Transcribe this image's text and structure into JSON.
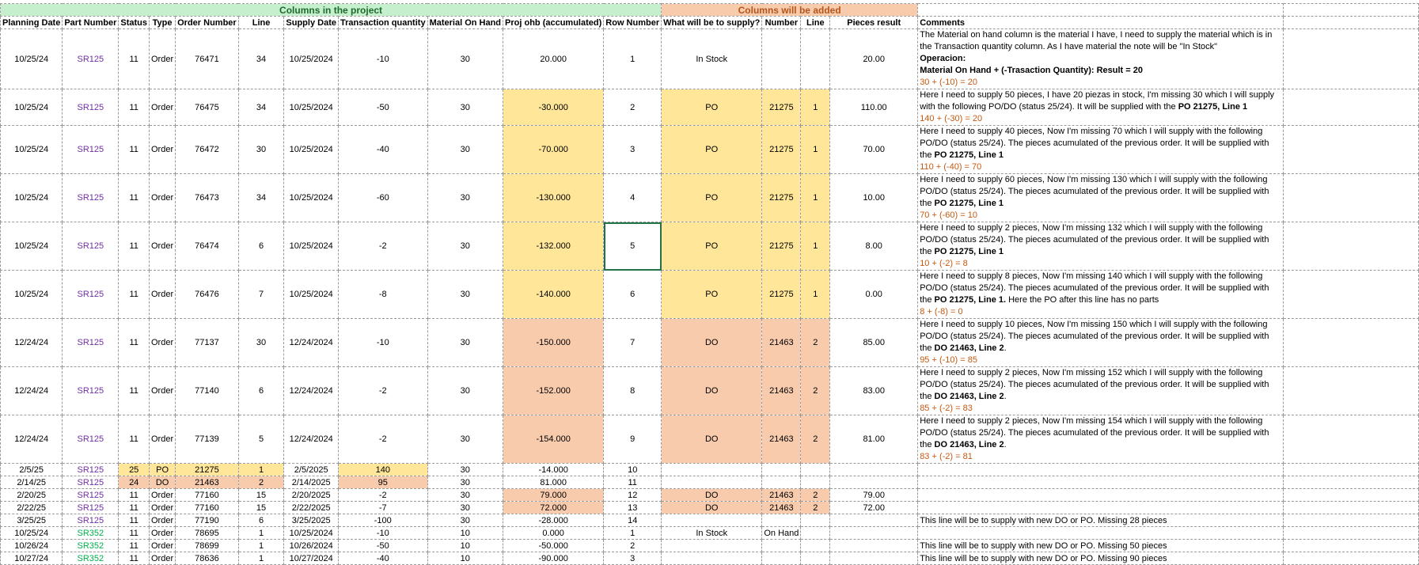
{
  "band": {
    "project": "Columns in the project",
    "added": "Columns will be added"
  },
  "headers": [
    "Planning Date",
    "Part Number",
    "Status",
    "Type",
    "Order Number",
    "Line",
    "Supply Date",
    "Transaction quantity",
    "Material On Hand",
    "Proj ohb (accumulated)",
    "Row Number",
    "What will be to supply?",
    "Number",
    "Line",
    "Pieces result",
    "Comments"
  ],
  "rows": [
    {
      "pd": "10/25/24",
      "pn": "SR125",
      "st": "11",
      "ty": "Order",
      "on": "76471",
      "ln": "34",
      "sd": "10/25/2024",
      "tq": "-10",
      "moh": "30",
      "proj": "20.000",
      "rn": "1",
      "what": "In Stock",
      "num": "",
      "ln2": "",
      "pr": "20.00",
      "hl": "",
      "comment": {
        "parts": [
          {
            "t": "The Material on hand column is the material I have, I need to supply the material which is in the Transaction quantity column. As I have material the note will be \"In Stock\""
          },
          {
            "t": "Operacion:",
            "b": true,
            "br": true
          },
          {
            "t": "Material On Hand + (-Trasaction Quantity): Result = 20",
            "b": true,
            "br": true
          }
        ],
        "calc": "30 + (-10) = 20"
      }
    },
    {
      "pd": "10/25/24",
      "pn": "SR125",
      "st": "11",
      "ty": "Order",
      "on": "76475",
      "ln": "34",
      "sd": "10/25/2024",
      "tq": "-50",
      "moh": "30",
      "proj": "-30.000",
      "rn": "2",
      "what": "PO",
      "num": "21275",
      "ln2": "1",
      "pr": "110.00",
      "hl": "y",
      "comment": {
        "parts": [
          {
            "t": "Here I need to supply 50 pieces, I have 20 piezas in stock, I'm missing 30 which I will supply with the following PO/DO (status 25/24). It will be supplied with the "
          },
          {
            "t": "PO 21275, Line 1",
            "b": true
          }
        ],
        "calc": "140 + (-30) = 20"
      }
    },
    {
      "pd": "10/25/24",
      "pn": "SR125",
      "st": "11",
      "ty": "Order",
      "on": "76472",
      "ln": "30",
      "sd": "10/25/2024",
      "tq": "-40",
      "moh": "30",
      "proj": "-70.000",
      "rn": "3",
      "what": "PO",
      "num": "21275",
      "ln2": "1",
      "pr": "70.00",
      "hl": "y",
      "comment": {
        "parts": [
          {
            "t": "Here I need to supply 40 pieces, Now I'm missing 70 which I will supply with the following PO/DO (status 25/24). The pieces acumulated of the previous order. It will be supplied with the "
          },
          {
            "t": "PO 21275, Line 1",
            "b": true
          }
        ],
        "calc": "110 + (-40) = 70"
      }
    },
    {
      "pd": "10/25/24",
      "pn": "SR125",
      "st": "11",
      "ty": "Order",
      "on": "76473",
      "ln": "34",
      "sd": "10/25/2024",
      "tq": "-60",
      "moh": "30",
      "proj": "-130.000",
      "rn": "4",
      "what": "PO",
      "num": "21275",
      "ln2": "1",
      "pr": "10.00",
      "hl": "y",
      "comment": {
        "parts": [
          {
            "t": "Here I need to supply 60 pieces, Now I'm missing 130 which I will supply with the following PO/DO (status 25/24). The pieces acumulated of the previous order. It will be supplied with the "
          },
          {
            "t": "PO 21275, Line 1",
            "b": true
          }
        ],
        "calc": "70 + (-60) = 10"
      }
    },
    {
      "pd": "10/25/24",
      "pn": "SR125",
      "st": "11",
      "ty": "Order",
      "on": "76474",
      "ln": "6",
      "sd": "10/25/2024",
      "tq": "-2",
      "moh": "30",
      "proj": "-132.000",
      "rn": "5",
      "what": "PO",
      "num": "21275",
      "ln2": "1",
      "pr": "8.00",
      "hl": "y",
      "sel": true,
      "comment": {
        "parts": [
          {
            "t": "Here I need to supply 2 pieces, Now I'm missing 132 which I will supply with the following PO/DO (status 25/24). The pieces acumulated of the previous order. It will be supplied with the "
          },
          {
            "t": "PO 21275, Line 1",
            "b": true
          }
        ],
        "calc": "10 + (-2) = 8"
      }
    },
    {
      "pd": "10/25/24",
      "pn": "SR125",
      "st": "11",
      "ty": "Order",
      "on": "76476",
      "ln": "7",
      "sd": "10/25/2024",
      "tq": "-8",
      "moh": "30",
      "proj": "-140.000",
      "rn": "6",
      "what": "PO",
      "num": "21275",
      "ln2": "1",
      "pr": "0.00",
      "hl": "y",
      "comment": {
        "parts": [
          {
            "t": "Here I need to supply 8 pieces, Now I'm missing 140 which I will supply with the following PO/DO (status 25/24). The pieces acumulated of the previous order. It will be supplied with the "
          },
          {
            "t": "PO 21275, Line 1.",
            "b": true
          },
          {
            "t": " Here the PO after this line has no parts"
          }
        ],
        "calc": "8 + (-8) = 0"
      }
    },
    {
      "pd": "12/24/24",
      "pn": "SR125",
      "st": "11",
      "ty": "Order",
      "on": "77137",
      "ln": "30",
      "sd": "12/24/2024",
      "tq": "-10",
      "moh": "30",
      "proj": "-150.000",
      "rn": "7",
      "what": "DO",
      "num": "21463",
      "ln2": "2",
      "pr": "85.00",
      "hl": "s",
      "comment": {
        "parts": [
          {
            "t": "Here I need to supply 10 pieces, Now I'm missing 150 which I will supply with the following PO/DO (status 25/24). The pieces acumulated of the previous order. It will be supplied with the "
          },
          {
            "t": "DO 21463, Line 2",
            "b": true
          },
          {
            "t": "."
          }
        ],
        "calc": "95 + (-10) = 85"
      }
    },
    {
      "pd": "12/24/24",
      "pn": "SR125",
      "st": "11",
      "ty": "Order",
      "on": "77140",
      "ln": "6",
      "sd": "12/24/2024",
      "tq": "-2",
      "moh": "30",
      "proj": "-152.000",
      "rn": "8",
      "what": "DO",
      "num": "21463",
      "ln2": "2",
      "pr": "83.00",
      "hl": "s",
      "comment": {
        "parts": [
          {
            "t": "Here I need to supply 2 pieces, Now I'm missing 152 which I will supply with the following PO/DO (status 25/24). The pieces acumulated of the previous order. It will be supplied with the "
          },
          {
            "t": "DO 21463, Line 2",
            "b": true
          },
          {
            "t": "."
          }
        ],
        "calc": "85 + (-2) = 83"
      }
    },
    {
      "pd": "12/24/24",
      "pn": "SR125",
      "st": "11",
      "ty": "Order",
      "on": "77139",
      "ln": "5",
      "sd": "12/24/2024",
      "tq": "-2",
      "moh": "30",
      "proj": "-154.000",
      "rn": "9",
      "what": "DO",
      "num": "21463",
      "ln2": "2",
      "pr": "81.00",
      "hl": "s",
      "comment": {
        "parts": [
          {
            "t": "Here I need to supply 2 pieces, Now I'm missing 154 which I will supply with the following PO/DO (status 25/24). The pieces acumulated of the previous order. It will be supplied with the "
          },
          {
            "t": "DO 21463, Line 2",
            "b": true
          },
          {
            "t": "."
          }
        ],
        "calc": "83 + (-2) = 81"
      }
    }
  ],
  "short_rows": [
    {
      "pd": "2/5/25",
      "pn": "SR125",
      "pc": "1",
      "st": "25",
      "ty": "PO",
      "on": "21275",
      "ln": "1",
      "sd": "2/5/2025",
      "tq": "140",
      "moh": "30",
      "proj": "-14.000",
      "rn": "10",
      "what": "",
      "num": "",
      "ln2": "",
      "pr": "",
      "cm": "",
      "fill": "y"
    },
    {
      "pd": "2/14/25",
      "pn": "SR125",
      "pc": "1",
      "st": "24",
      "ty": "DO",
      "on": "21463",
      "ln": "2",
      "sd": "2/14/2025",
      "tq": "95",
      "moh": "30",
      "proj": "81.000",
      "rn": "11",
      "what": "",
      "num": "",
      "ln2": "",
      "pr": "",
      "cm": "",
      "fill": "s"
    },
    {
      "pd": "2/20/25",
      "pn": "SR125",
      "pc": "1",
      "st": "11",
      "ty": "Order",
      "on": "77160",
      "ln": "15",
      "sd": "2/20/2025",
      "tq": "-2",
      "moh": "30",
      "proj": "79.000",
      "rn": "12",
      "what": "DO",
      "num": "21463",
      "ln2": "2",
      "pr": "79.00",
      "cm": "",
      "fill": "p"
    },
    {
      "pd": "2/22/25",
      "pn": "SR125",
      "pc": "1",
      "st": "11",
      "ty": "Order",
      "on": "77160",
      "ln": "15",
      "sd": "2/22/2025",
      "tq": "-7",
      "moh": "30",
      "proj": "72.000",
      "rn": "13",
      "what": "DO",
      "num": "21463",
      "ln2": "2",
      "pr": "72.00",
      "cm": "",
      "fill": "p"
    },
    {
      "pd": "3/25/25",
      "pn": "SR125",
      "pc": "1",
      "st": "11",
      "ty": "Order",
      "on": "77190",
      "ln": "6",
      "sd": "3/25/2025",
      "tq": "-100",
      "moh": "30",
      "proj": "-28.000",
      "rn": "14",
      "what": "",
      "num": "",
      "ln2": "",
      "pr": "",
      "cm": "This line will be to supply with new DO or PO. Missing 28 pieces",
      "fill": ""
    },
    {
      "pd": "10/25/24",
      "pn": "SR352",
      "pc": "2",
      "st": "11",
      "ty": "Order",
      "on": "78695",
      "ln": "1",
      "sd": "10/25/2024",
      "tq": "-10",
      "moh": "10",
      "proj": "0.000",
      "rn": "1",
      "what": "In Stock",
      "num": "On Hand",
      "ln2": "",
      "pr": "",
      "cm": "",
      "fill": ""
    },
    {
      "pd": "10/26/24",
      "pn": "SR352",
      "pc": "2",
      "st": "11",
      "ty": "Order",
      "on": "78699",
      "ln": "1",
      "sd": "10/26/2024",
      "tq": "-50",
      "moh": "10",
      "proj": "-50.000",
      "rn": "2",
      "what": "",
      "num": "",
      "ln2": "",
      "pr": "",
      "cm": "This line will be to supply with new DO or PO. Missing 50 pieces",
      "fill": ""
    },
    {
      "pd": "10/27/24",
      "pn": "SR352",
      "pc": "2",
      "st": "11",
      "ty": "Order",
      "on": "78636",
      "ln": "1",
      "sd": "10/27/2024",
      "tq": "-40",
      "moh": "10",
      "proj": "-90.000",
      "rn": "3",
      "what": "",
      "num": "",
      "ln2": "",
      "pr": "",
      "cm": "This line will be to supply with new DO or PO. Missing 90 pieces",
      "fill": ""
    }
  ]
}
